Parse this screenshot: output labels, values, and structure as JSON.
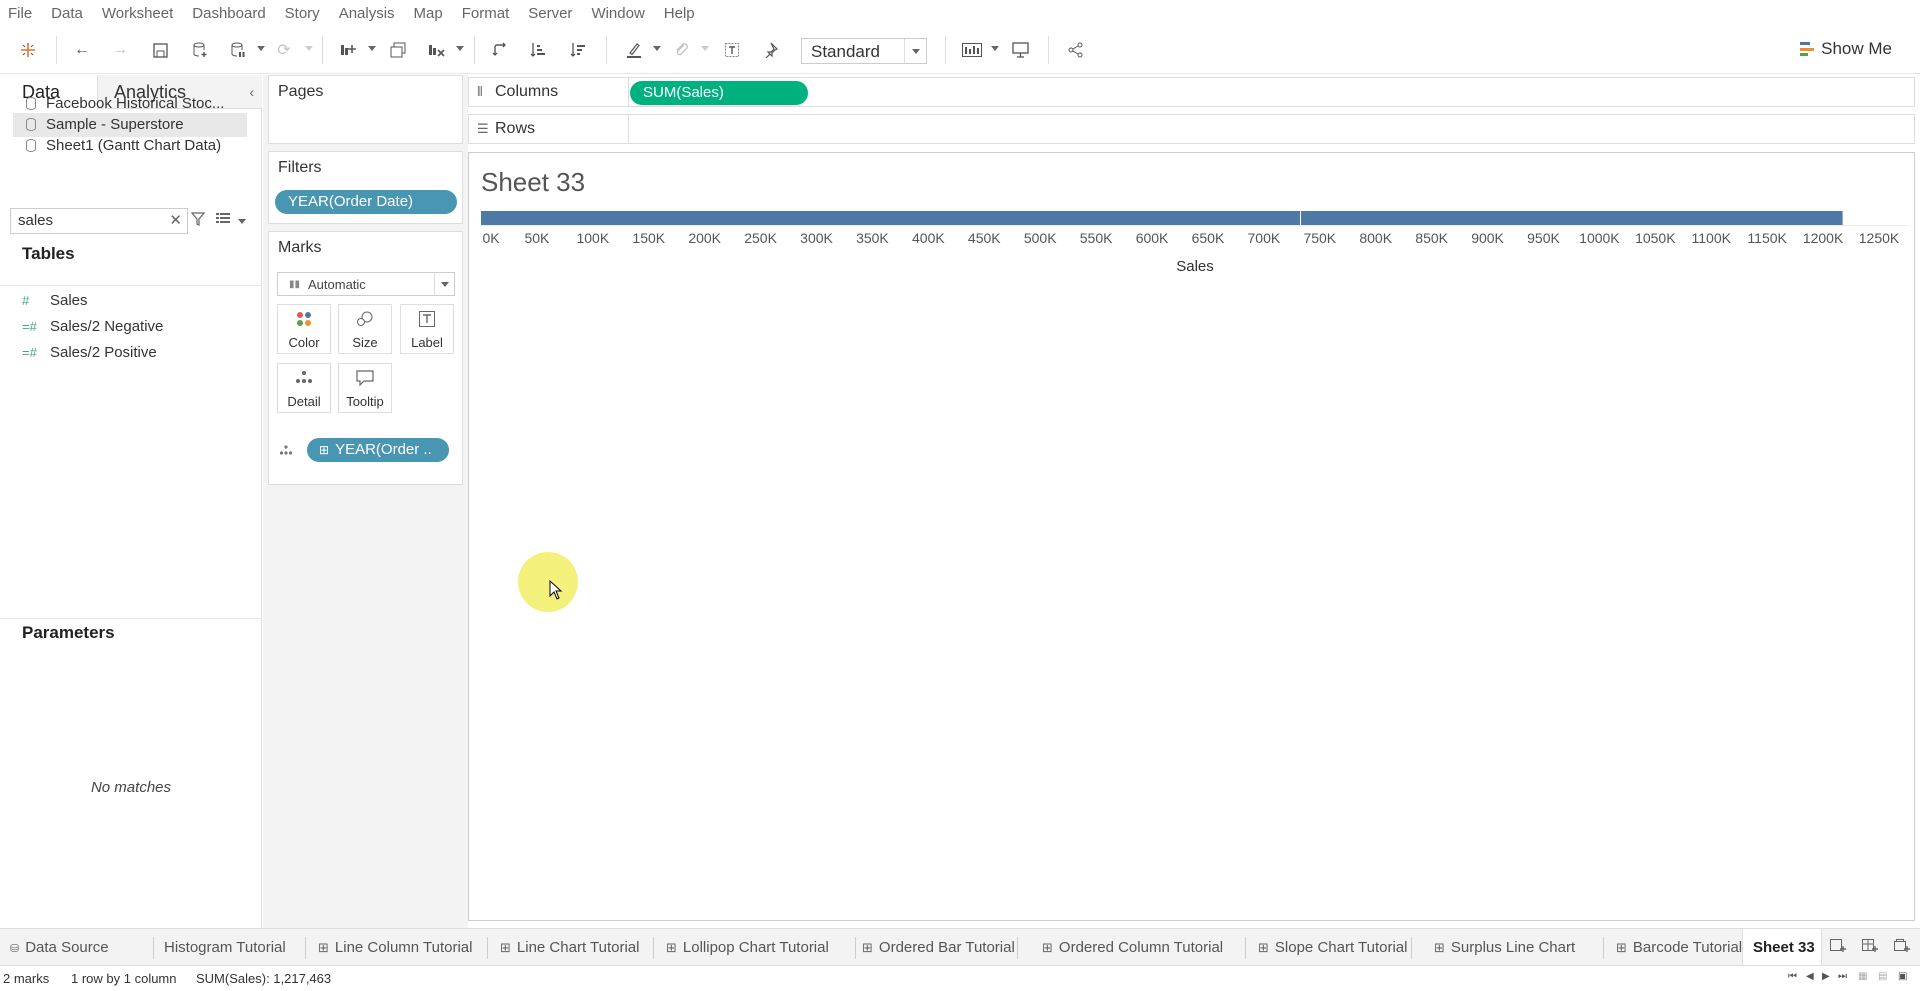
{
  "menu": [
    "File",
    "Data",
    "Worksheet",
    "Dashboard",
    "Story",
    "Analysis",
    "Map",
    "Format",
    "Server",
    "Window",
    "Help"
  ],
  "toolbar": {
    "fit_select": "Standard",
    "show_me": "Show Me"
  },
  "data_pane": {
    "tab_data": "Data",
    "tab_analytics": "Analytics",
    "data_sources": [
      {
        "label": "Facebook Historical Stoc...",
        "selected": false
      },
      {
        "label": "Sample - Superstore",
        "selected": true
      },
      {
        "label": "Sheet1 (Gantt Chart Data)",
        "selected": false
      }
    ],
    "search_value": "sales",
    "tables_heading": "Tables",
    "fields": [
      {
        "icon": "#",
        "label": "Sales"
      },
      {
        "icon": "=#",
        "label": "Sales/2 Negative"
      },
      {
        "icon": "=#",
        "label": "Sales/2 Positive"
      }
    ],
    "parameters_heading": "Parameters",
    "no_matches": "No matches"
  },
  "cards": {
    "pages": "Pages",
    "filters": "Filters",
    "filter_pill": "YEAR(Order Date)",
    "marks": "Marks",
    "mark_type": "Automatic",
    "mark_buttons": [
      "Color",
      "Size",
      "Label",
      "Detail",
      "Tooltip"
    ],
    "marks_pill": "YEAR(Order .."
  },
  "shelves": {
    "columns_label": "Columns",
    "columns_pill": "SUM(Sales)",
    "rows_label": "Rows"
  },
  "sheet": {
    "title": "Sheet 33"
  },
  "chart_data": {
    "type": "bar",
    "orientation": "horizontal",
    "stacked": true,
    "title": "Sheet 33",
    "xlabel": "Sales",
    "xlim": [
      0,
      1250000
    ],
    "x_ticks": [
      "0K",
      "50K",
      "100K",
      "150K",
      "200K",
      "250K",
      "300K",
      "350K",
      "400K",
      "450K",
      "500K",
      "550K",
      "600K",
      "650K",
      "700K",
      "750K",
      "800K",
      "850K",
      "900K",
      "950K",
      "1000K",
      "1050K",
      "1100K",
      "1150K",
      "1200K",
      "1250K"
    ],
    "segments": [
      {
        "value": 733215
      },
      {
        "value": 484248
      }
    ],
    "total": 1217463,
    "bar_color": "#4e79a7"
  },
  "sheet_tabs": [
    {
      "label": "Data Source",
      "icon": "db"
    },
    {
      "label": "Histogram Tutorial",
      "icon": ""
    },
    {
      "label": "Line Column Tutorial",
      "icon": "grid"
    },
    {
      "label": "Line Chart Tutorial",
      "icon": "grid"
    },
    {
      "label": "Lollipop Chart Tutorial",
      "icon": "grid"
    },
    {
      "label": "Ordered Bar Tutorial",
      "icon": "grid"
    },
    {
      "label": "Ordered Column Tutorial",
      "icon": "grid"
    },
    {
      "label": "Slope Chart Tutorial",
      "icon": "grid"
    },
    {
      "label": "Surplus Line Chart",
      "icon": "grid"
    },
    {
      "label": "Barcode Tutorial",
      "icon": "grid"
    },
    {
      "label": "Sheet 33",
      "icon": "",
      "active": true
    }
  ],
  "status": {
    "marks": "2 marks",
    "rows_cols": "1 row by 1 column",
    "sum": "SUM(Sales): 1,217,463"
  }
}
